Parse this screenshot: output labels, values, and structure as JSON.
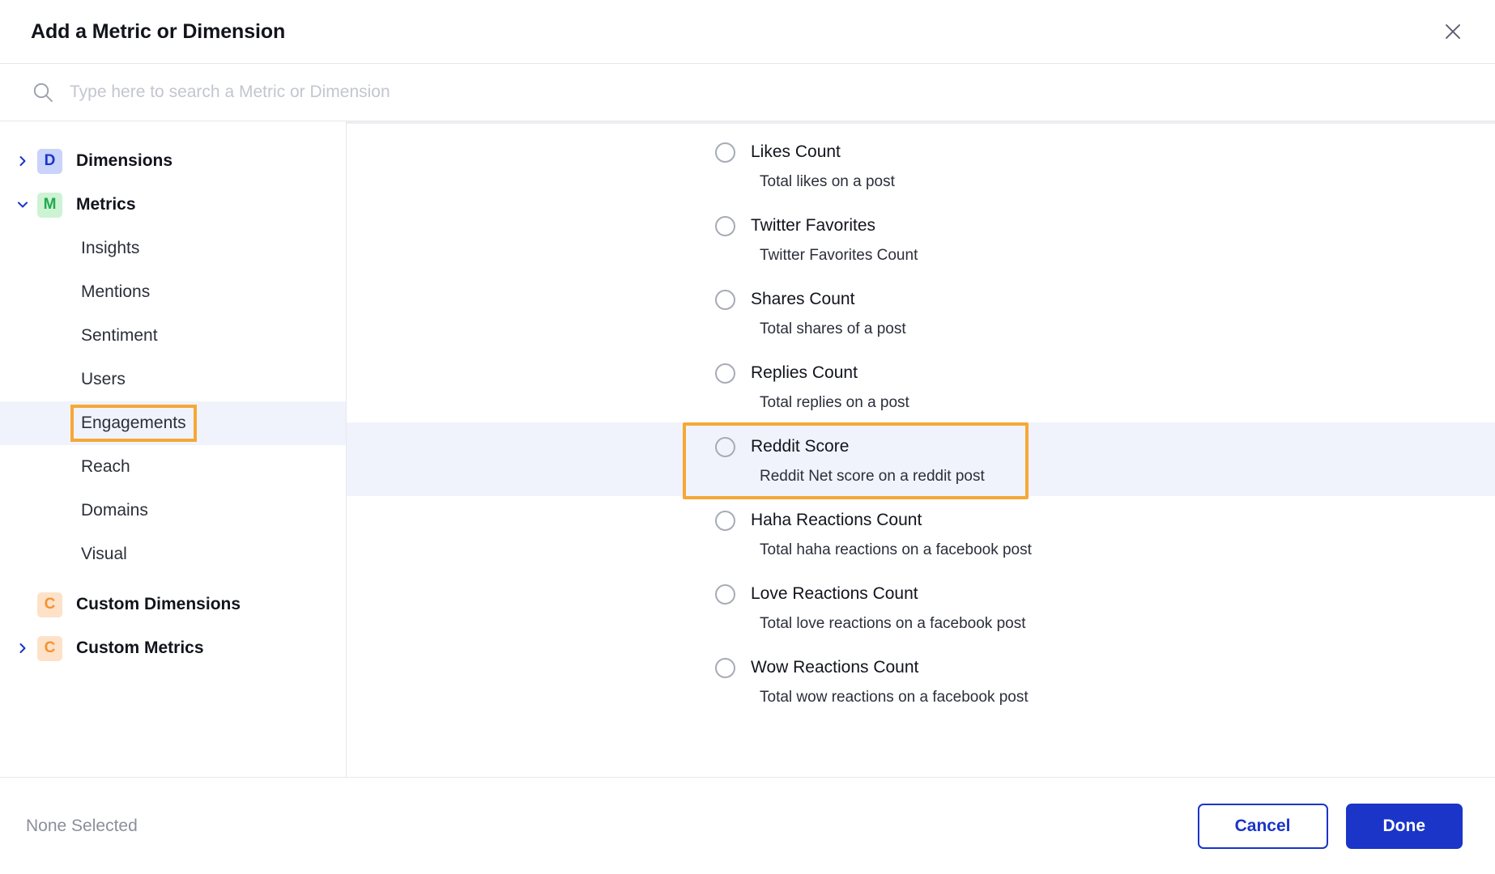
{
  "header": {
    "title": "Add a Metric or Dimension",
    "close_icon": "close-icon"
  },
  "search": {
    "icon": "search-icon",
    "value": "",
    "placeholder": "Type here to search a Metric or Dimension"
  },
  "sidebar": {
    "groups": [
      {
        "label": "Dimensions",
        "badge": "D",
        "chevron": "chevron-right-icon",
        "expanded": false,
        "items": []
      },
      {
        "label": "Metrics",
        "badge": "M",
        "chevron": "chevron-down-icon",
        "expanded": true,
        "items": [
          {
            "label": "Insights",
            "selected": false
          },
          {
            "label": "Mentions",
            "selected": false
          },
          {
            "label": "Sentiment",
            "selected": false
          },
          {
            "label": "Users",
            "selected": false
          },
          {
            "label": "Engagements",
            "selected": true
          },
          {
            "label": "Reach",
            "selected": false
          },
          {
            "label": "Domains",
            "selected": false
          },
          {
            "label": "Visual",
            "selected": false
          }
        ]
      },
      {
        "label": "Custom Dimensions",
        "badge": "C",
        "chevron": "",
        "expanded": false,
        "items": []
      },
      {
        "label": "Custom Metrics",
        "badge": "C",
        "chevron": "chevron-right-icon",
        "expanded": false,
        "items": []
      }
    ]
  },
  "list": {
    "rows": [
      {
        "title": "Likes Count",
        "description": "Total likes on a post",
        "selected": false,
        "highlighted": false
      },
      {
        "title": "Twitter Favorites",
        "description": "Twitter Favorites Count",
        "selected": false,
        "highlighted": false
      },
      {
        "title": "Shares Count",
        "description": "Total shares of a post",
        "selected": false,
        "highlighted": false
      },
      {
        "title": "Replies Count",
        "description": "Total replies on a post",
        "selected": false,
        "highlighted": false
      },
      {
        "title": "Reddit Score",
        "description": "Reddit Net score on a reddit post",
        "selected": false,
        "highlighted": true
      },
      {
        "title": "Haha Reactions Count",
        "description": "Total haha reactions on a facebook post",
        "selected": false,
        "highlighted": false
      },
      {
        "title": "Love Reactions Count",
        "description": "Total love reactions on a facebook post",
        "selected": false,
        "highlighted": false
      },
      {
        "title": "Wow Reactions Count",
        "description": "Total wow reactions on a facebook post",
        "selected": false,
        "highlighted": false
      }
    ]
  },
  "footer": {
    "status": "None Selected",
    "cancel_label": "Cancel",
    "done_label": "Done"
  },
  "colors": {
    "primary_blue": "#1a35c8",
    "annotation_orange": "#f5a837",
    "row_highlight": "#f1f3fc",
    "badge_dimension_bg": "#c9d3fb",
    "badge_metric_bg": "#cdf3d4",
    "badge_custom_bg": "#fde2c9"
  }
}
